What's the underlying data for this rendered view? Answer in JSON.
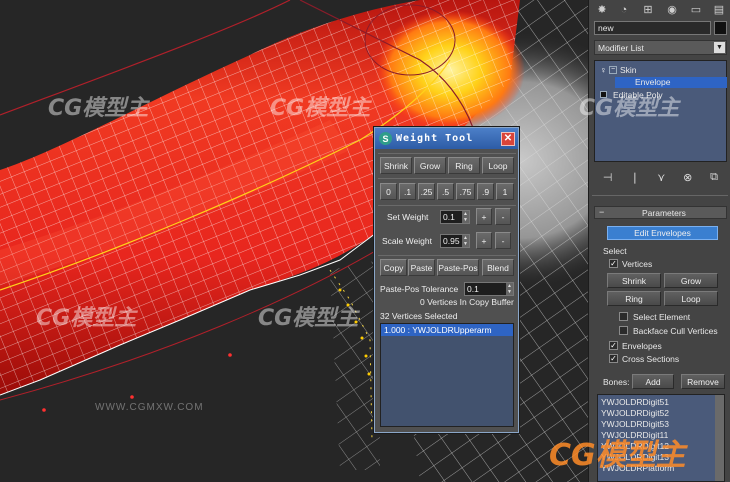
{
  "weight_tool": {
    "title": "Weight Tool",
    "close_glyph": "✕",
    "row1": [
      "Shrink",
      "Grow",
      "Ring",
      "Loop"
    ],
    "presets": [
      "0",
      ".1",
      ".25",
      ".5",
      ".75",
      ".9",
      "1"
    ],
    "set_weight_label": "Set Weight",
    "set_weight_value": "0.1",
    "scale_weight_label": "Scale Weight",
    "scale_weight_value": "0.95",
    "plus": "+",
    "minus": "-",
    "row_copy": [
      "Copy",
      "Paste",
      "Paste-Pos",
      "Blend"
    ],
    "tolerance_label": "Paste-Pos Tolerance",
    "tolerance_value": "0.1",
    "copy_buffer_status": "0 Vertices In Copy Buffer",
    "selected_status": "32 Vertices Selected",
    "weight_list": [
      "1.000 : YWJOLDRUpperarm"
    ]
  },
  "panel": {
    "object_name": "new",
    "modifier_list_label": "Modifier List",
    "stack": [
      {
        "label": "Skin",
        "level": 0
      },
      {
        "label": "Envelope",
        "level": 1,
        "selected": true
      },
      {
        "label": "Editable Poly",
        "level": 0
      }
    ],
    "parameters_title": "Parameters",
    "edit_envelopes": "Edit Envelopes",
    "select_group": "Select",
    "vertices_label": "Vertices",
    "shrink": "Shrink",
    "grow": "Grow",
    "ring": "Ring",
    "loop": "Loop",
    "select_element": "Select Element",
    "backface_cull": "Backface Cull Vertices",
    "envelopes_label": "Envelopes",
    "cross_sections_label": "Cross Sections",
    "bones_label": "Bones:",
    "add": "Add",
    "remove": "Remove",
    "bones": [
      "YWJOLDRDigit51",
      "YWJOLDRDigit52",
      "YWJOLDRDigit53",
      "YWJOLDRDigit11",
      "YWJOLDRDigit12",
      "YWJOLDRDigit13",
      "YWJOLDRPlatform"
    ]
  },
  "watermark": {
    "brand": "CG模型主",
    "url": "WWW.CGMXW.COM"
  },
  "colors": {
    "mesh_red": "#e8261e",
    "weight_yellow": "#ffd21a",
    "selection_blue": "#2e64c4",
    "titlebar_blue": "#3d6fbd"
  }
}
